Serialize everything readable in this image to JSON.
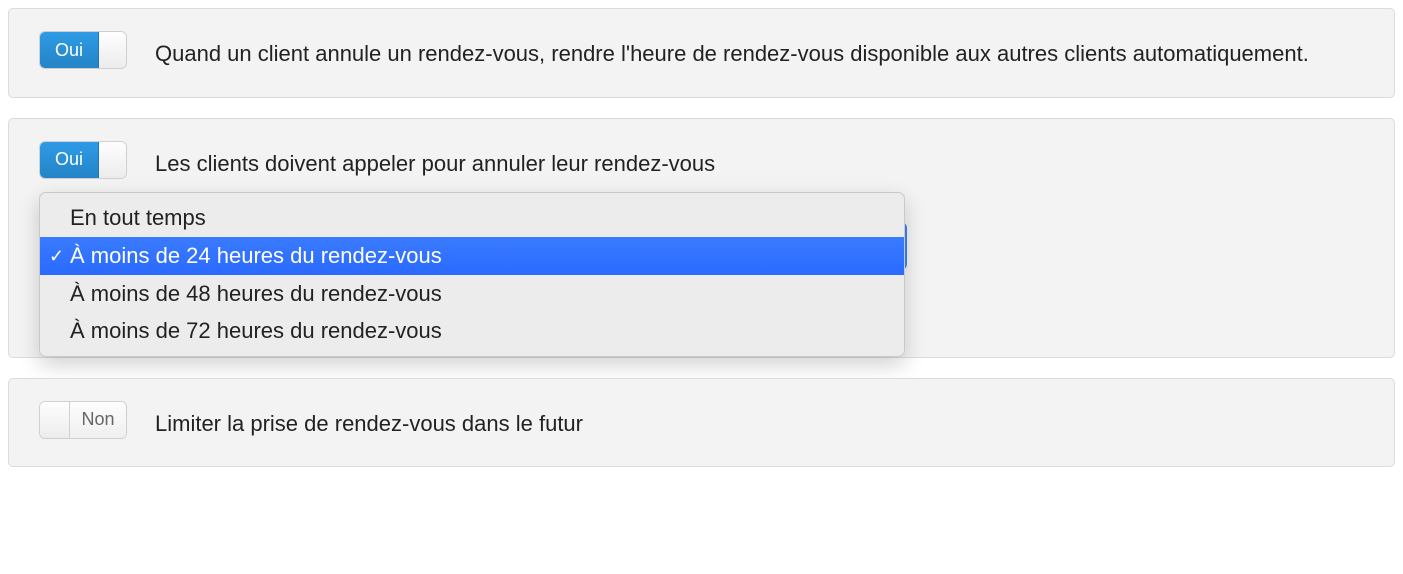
{
  "toggle_labels": {
    "on": "Oui",
    "off": "Non"
  },
  "settings": {
    "autoRelease": {
      "state": "on",
      "desc": "Quand un client annule un rendez-vous, rendre l'heure de rendez-vous disponible aux autres clients automatiquement."
    },
    "mustCall": {
      "state": "on",
      "desc": "Les clients doivent appeler pour annuler leur rendez-vous"
    },
    "limitFuture": {
      "state": "off",
      "desc": "Limiter la prise de rendez-vous dans le futur"
    }
  },
  "dropdown": {
    "options": [
      "En tout temps",
      "À moins de 24 heures du rendez-vous",
      "À moins de 48 heures du rendez-vous",
      "À moins de 72 heures du rendez-vous"
    ],
    "selectedIndex": 1
  }
}
